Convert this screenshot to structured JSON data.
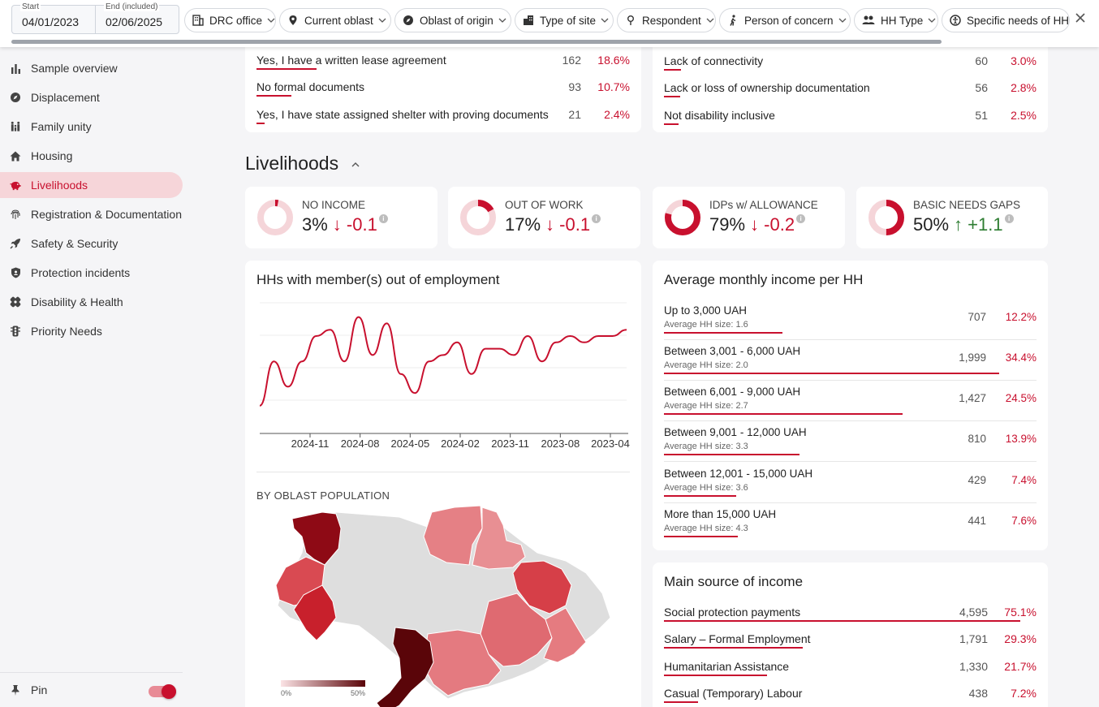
{
  "filters": {
    "start_label": "Start",
    "start_value": "04/01/2023",
    "end_label": "End (included)",
    "end_value": "02/06/2025",
    "chips": [
      {
        "label": "DRC office",
        "icon": "building-icon"
      },
      {
        "label": "Current oblast",
        "icon": "location-pin-icon"
      },
      {
        "label": "Oblast of origin",
        "icon": "compass-icon"
      },
      {
        "label": "Type of site",
        "icon": "city-icon"
      },
      {
        "label": "Respondent",
        "icon": "person-pin-icon"
      },
      {
        "label": "Person of concern",
        "icon": "walking-person-icon"
      },
      {
        "label": "HH Type",
        "icon": "group-icon"
      },
      {
        "label": "Specific needs of HH",
        "icon": "accessibility-icon"
      }
    ]
  },
  "sidebar": {
    "items": [
      {
        "label": "Sample overview",
        "icon": "bar-chart-icon"
      },
      {
        "label": "Displacement",
        "icon": "compass-icon"
      },
      {
        "label": "Family unity",
        "icon": "family-icon"
      },
      {
        "label": "Housing",
        "icon": "home-icon"
      },
      {
        "label": "Livelihoods",
        "icon": "piggy-bank-icon",
        "active": true
      },
      {
        "label": "Registration & Documentation",
        "icon": "fingerprint-icon"
      },
      {
        "label": "Safety & Security",
        "icon": "rocket-icon"
      },
      {
        "label": "Protection incidents",
        "icon": "shield-icon"
      },
      {
        "label": "Disability & Health",
        "icon": "bandage-icon"
      },
      {
        "label": "Priority Needs",
        "icon": "traffic-light-icon"
      }
    ],
    "pin_label": "Pin",
    "pin_on": true
  },
  "shelter_docs": {
    "rows": [
      {
        "label": "Yes, I have a written lease agreement",
        "count": "162",
        "pct": "18.6%",
        "share": 0.186
      },
      {
        "label": "No formal documents",
        "count": "93",
        "pct": "10.7%",
        "share": 0.107
      },
      {
        "label": "Yes, I have state assigned shelter with proving documents",
        "count": "21",
        "pct": "2.4%",
        "share": 0.024
      }
    ]
  },
  "housing_issues": {
    "rows": [
      {
        "label": "Lack of connectivity",
        "count": "60",
        "pct": "3.0%",
        "share": 0.03
      },
      {
        "label": "Lack or loss of ownership documentation",
        "count": "56",
        "pct": "2.8%",
        "share": 0.028
      },
      {
        "label": "Not disability inclusive",
        "count": "51",
        "pct": "2.5%",
        "share": 0.025
      }
    ]
  },
  "section": {
    "title": "Livelihoods"
  },
  "kpis": [
    {
      "label": "NO INCOME",
      "value": "3%",
      "delta": "-0.1",
      "direction": "down",
      "fraction": 0.03
    },
    {
      "label": "OUT OF WORK",
      "value": "17%",
      "delta": "-0.1",
      "direction": "down",
      "fraction": 0.17
    },
    {
      "label": "IDPs w/ ALLOWANCE",
      "value": "79%",
      "delta": "-0.2",
      "direction": "down",
      "fraction": 0.79
    },
    {
      "label": "BASIC NEEDS GAPS",
      "value": "50%",
      "delta": "+1.1",
      "direction": "up",
      "fraction": 0.5
    }
  ],
  "employment_chart": {
    "title": "HHs with member(s) out of employment",
    "chart_data": {
      "type": "line",
      "x_ticks": [
        "2024-11",
        "2024-08",
        "2024-05",
        "2024-02",
        "2023-11",
        "2023-08",
        "2023-04"
      ],
      "values": [
        0.22,
        0.29,
        0.25,
        0.29,
        0.33,
        0.34,
        0.29,
        0.36,
        0.3,
        0.35,
        0.27,
        0.24,
        0.29,
        0.3,
        0.32,
        0.27,
        0.31,
        0.31,
        0.3,
        0.33,
        0.29,
        0.32,
        0.33,
        0.32,
        0.33,
        0.33,
        0.34
      ],
      "grid": true,
      "color": "#c8102e"
    }
  },
  "map": {
    "title": "BY OBLAST POPULATION",
    "legend_min": "0%",
    "legend_max": "50%"
  },
  "avg_income": {
    "title": "Average monthly income per HH",
    "rows": [
      {
        "label": "Up to 3,000 UAH",
        "sub": "Average HH size: 1.6",
        "count": "707",
        "pct": "12.2%",
        "share": 0.122
      },
      {
        "label": "Between 3,001 - 6,000 UAH",
        "sub": "Average HH size: 2.0",
        "count": "1,999",
        "pct": "34.4%",
        "share": 0.344
      },
      {
        "label": "Between 6,001 - 9,000 UAH",
        "sub": "Average HH size: 2.7",
        "count": "1,427",
        "pct": "24.5%",
        "share": 0.245
      },
      {
        "label": "Between 9,001 - 12,000 UAH",
        "sub": "Average HH size: 3.3",
        "count": "810",
        "pct": "13.9%",
        "share": 0.139
      },
      {
        "label": "Between 12,001 - 15,000 UAH",
        "sub": "Average HH size: 3.6",
        "count": "429",
        "pct": "7.4%",
        "share": 0.074
      },
      {
        "label": "More than 15,000 UAH",
        "sub": "Average HH size: 4.3",
        "count": "441",
        "pct": "7.6%",
        "share": 0.076
      }
    ]
  },
  "main_income": {
    "title": "Main source of income",
    "rows": [
      {
        "label": "Social protection payments",
        "count": "4,595",
        "pct": "75.1%",
        "share": 0.751
      },
      {
        "label": "Salary – Formal Employment",
        "count": "1,791",
        "pct": "29.3%",
        "share": 0.293
      },
      {
        "label": "Humanitarian Assistance",
        "count": "1,330",
        "pct": "21.7%",
        "share": 0.217
      },
      {
        "label": "Casual (Temporary) Labour",
        "count": "438",
        "pct": "7.2%",
        "share": 0.072
      }
    ]
  }
}
